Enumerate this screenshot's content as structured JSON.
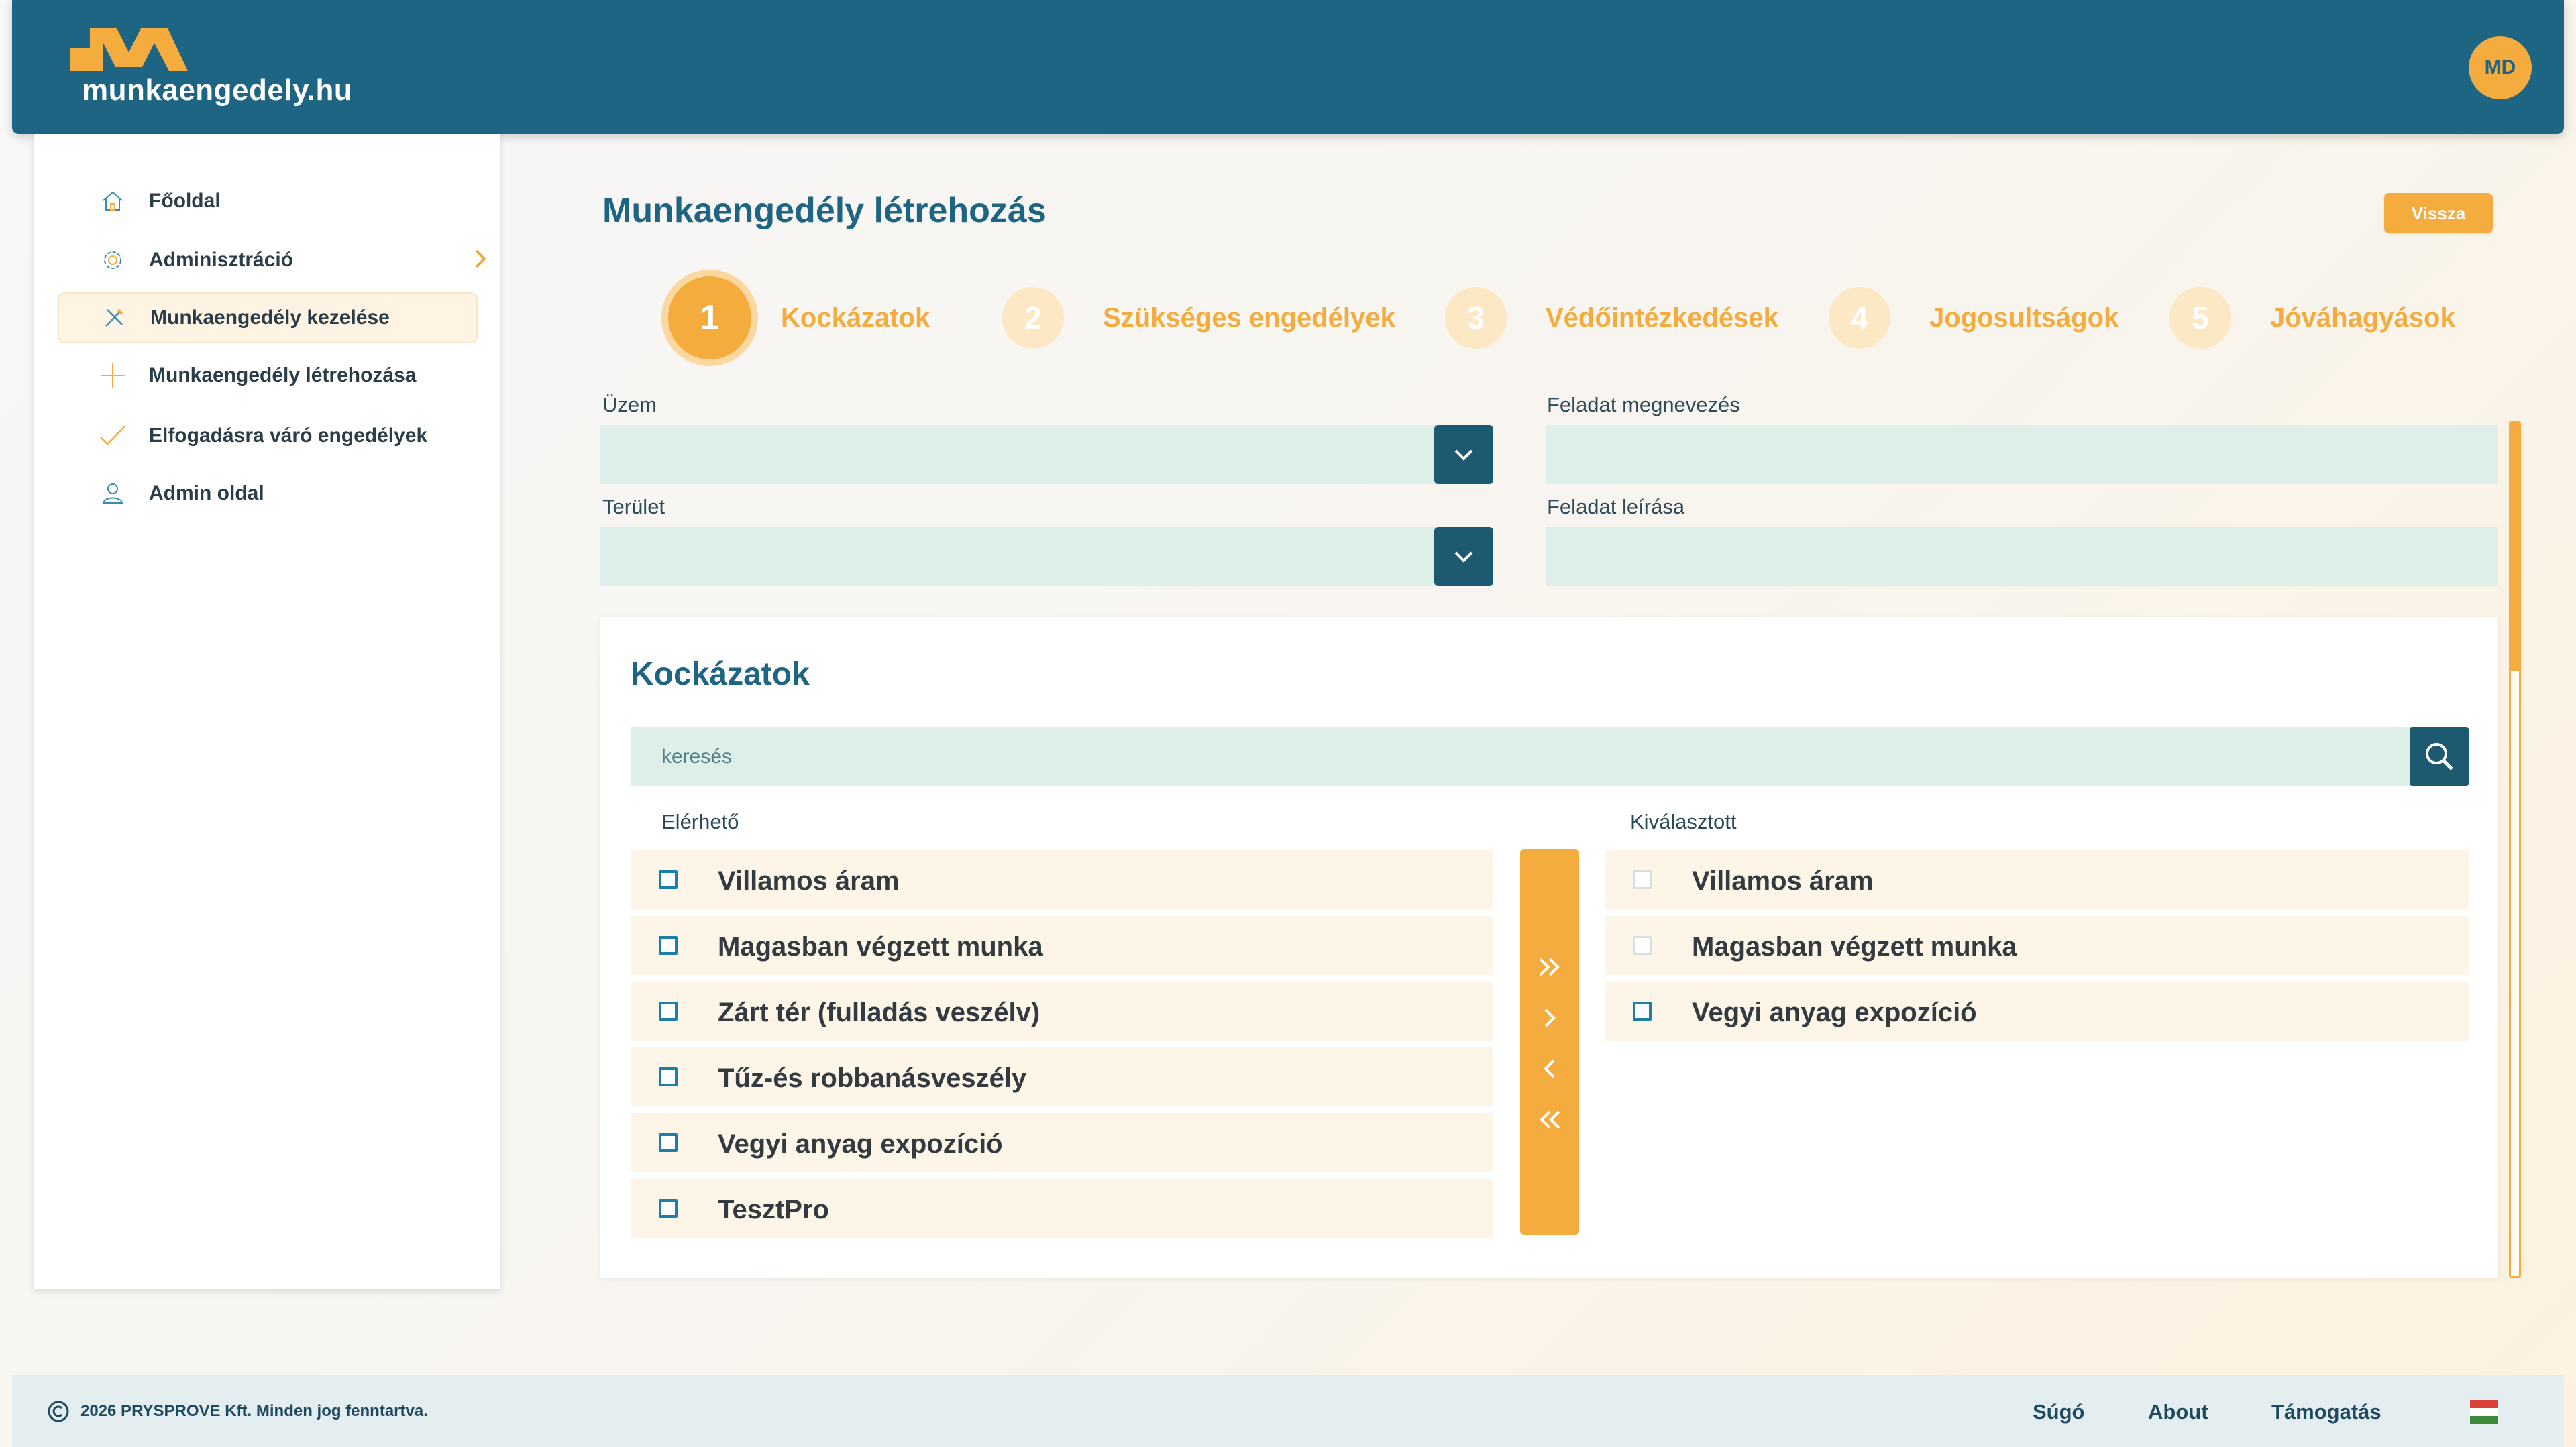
{
  "app": {
    "logo_text": "munkaengedely.hu",
    "user_initials": "MD",
    "brand_color": "#1d6583",
    "accent_color": "#f4ac3e"
  },
  "sidebar": {
    "items": [
      {
        "label": "Főoldal",
        "icon": "home-icon"
      },
      {
        "label": "Adminisztráció",
        "icon": "gear-icon",
        "has_submenu": true
      },
      {
        "label": "Munkaengedély kezelése",
        "icon": "tools-icon",
        "active": true
      },
      {
        "label": "Munkaengedély létrehozása",
        "icon": "plus-icon"
      },
      {
        "label": "Elfogadásra váró engedélyek",
        "icon": "check-icon"
      },
      {
        "label": "Admin oldal",
        "icon": "user-icon"
      }
    ]
  },
  "main": {
    "title": "Munkaengedély létrehozás",
    "back_label": "Vissza"
  },
  "stepper": {
    "steps": [
      {
        "number": "1",
        "label": "Kockázatok",
        "active": true
      },
      {
        "number": "2",
        "label": "Szükséges engedélyek"
      },
      {
        "number": "3",
        "label": "Védőintézkedések"
      },
      {
        "number": "4",
        "label": "Jogosultságok"
      },
      {
        "number": "5",
        "label": "Jóváhagyások"
      }
    ]
  },
  "form": {
    "plant_label": "Üzem",
    "plant_value": "",
    "area_label": "Terület",
    "area_value": "",
    "task_name_label": "Feladat megnevezés",
    "task_name_value": "",
    "task_desc_label": "Feladat leírása",
    "task_desc_value": ""
  },
  "risks": {
    "title": "Kockázatok",
    "search_placeholder": "keresés",
    "available_label": "Elérhető",
    "selected_label": "Kiválasztott",
    "available": [
      "Villamos áram",
      "Magasban végzett munka",
      "Zárt tér (fulladás veszélv)",
      "Tűz-és robbanásveszély",
      "Vegyi anyag expozíció",
      "TesztPro"
    ],
    "selected": [
      {
        "label": "Villamos áram",
        "checkbox_enabled": false
      },
      {
        "label": "Magasban végzett munka",
        "checkbox_enabled": false
      },
      {
        "label": "Vegyi anyag expozíció",
        "checkbox_enabled": true
      }
    ]
  },
  "footer": {
    "copyright": "2026 PRYSPROVE Kft. Minden jog fenntartva.",
    "links": [
      "Súgó",
      "About",
      "Támogatás"
    ],
    "language_flag": "hungary-flag-icon"
  }
}
